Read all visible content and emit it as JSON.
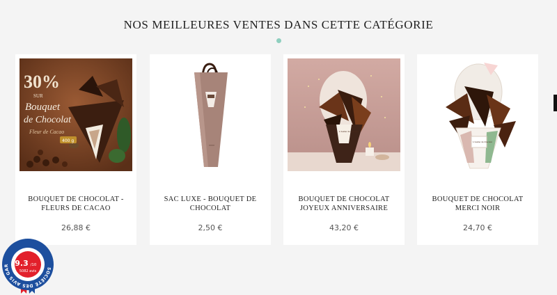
{
  "section": {
    "title": "NOS MEILLEURES VENTES DANS CETTE CATÉGORIE"
  },
  "products": [
    {
      "name": "BOUQUET DE CHOCOLAT - FLEURS DE CACAO",
      "price": "26,88 €",
      "promo": {
        "percent": "30%",
        "sur": "SUR",
        "line1": "Bouquet",
        "line2": "de Chocolat",
        "line3": "Fleur de Cacao",
        "weight": "400 g"
      }
    },
    {
      "name": "SAC LUXE - BOUQUET DE CHOCOLAT",
      "price": "2,50 €"
    },
    {
      "name": "BOUQUET DE CHOCOLAT JOYEUX ANNIVERSAIRE",
      "price": "43,20 €",
      "label": "L'Atelier du Chocolat"
    },
    {
      "name": "BOUQUET DE CHOCOLAT MERCI NOIR",
      "price": "24,70 €",
      "label": "L'Atelier du Chocolat"
    }
  ],
  "badge": {
    "score": "9.3",
    "scale": "/10",
    "count": "5082 avis",
    "ring_text": "SOCIÉTÉ DES AVIS GARANTIS"
  },
  "colors": {
    "accent_dot": "#8fcfbf",
    "badge_blue": "#1d4f9e",
    "badge_red": "#e2202b"
  }
}
